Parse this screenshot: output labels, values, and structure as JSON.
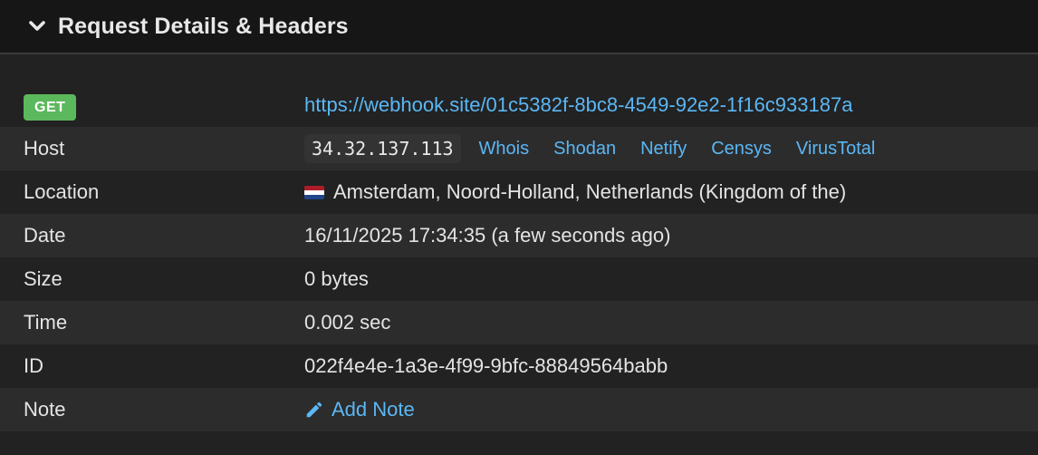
{
  "panel": {
    "title": "Request Details & Headers",
    "collapse_icon": "chevron-down-icon"
  },
  "request": {
    "method": "GET",
    "url": "https://webhook.site/01c5382f-8bc8-4549-92e2-1f16c933187a",
    "rows": {
      "host": {
        "label": "Host",
        "ip": "34.32.137.113"
      },
      "location": {
        "label": "Location",
        "value": "Amsterdam, Noord-Holland, Netherlands (Kingdom of the)",
        "flag_icon": "netherlands-flag-icon"
      },
      "date": {
        "label": "Date",
        "value": "16/11/2025 17:34:35 (a few seconds ago)"
      },
      "size": {
        "label": "Size",
        "value": "0 bytes"
      },
      "time": {
        "label": "Time",
        "value": "0.002 sec"
      },
      "id": {
        "label": "ID",
        "value": "022f4e4e-1a3e-4f99-9bfc-88849564babb"
      },
      "note": {
        "label": "Note",
        "action": "Add Note",
        "action_icon": "pencil-icon"
      }
    },
    "lookups": [
      "Whois",
      "Shodan",
      "Netify",
      "Censys",
      "VirusTotal"
    ]
  },
  "colors": {
    "link": "#5bb7f5",
    "badge_green": "#5cb85c",
    "header_bg": "#161616",
    "row_alt_bg": "#2c2c2c",
    "row_bg": "#222222"
  }
}
